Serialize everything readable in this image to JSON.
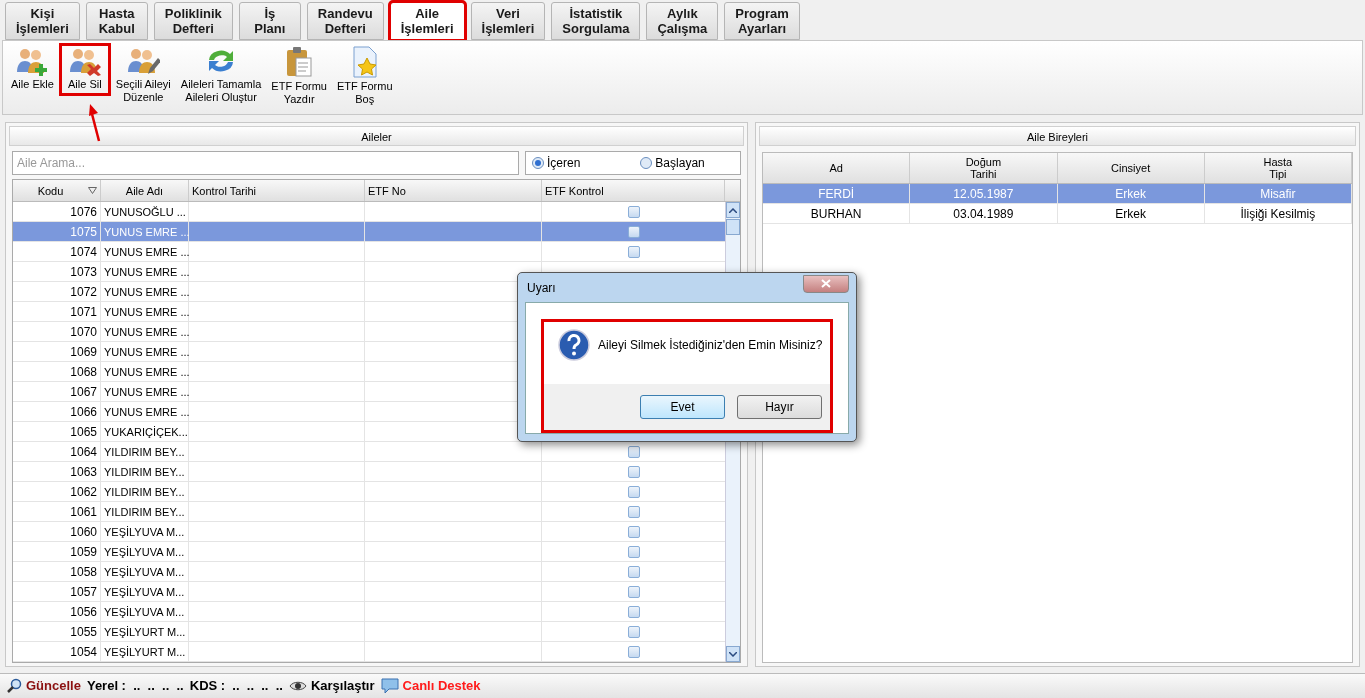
{
  "tabs": [
    {
      "label": "Kişi\nİşlemleri",
      "selected": false,
      "highlighted": false
    },
    {
      "label": "Hasta\nKabul",
      "selected": false,
      "highlighted": false
    },
    {
      "label": "Poliklinik\nDefteri",
      "selected": false,
      "highlighted": false
    },
    {
      "label": "İş\nPlanı",
      "selected": false,
      "highlighted": false
    },
    {
      "label": "Randevu\nDefteri",
      "selected": false,
      "highlighted": false
    },
    {
      "label": "Aile\nİşlemleri",
      "selected": true,
      "highlighted": true
    },
    {
      "label": "Veri\nİşlemleri",
      "selected": false,
      "highlighted": false
    },
    {
      "label": "İstatistik\nSorgulama",
      "selected": false,
      "highlighted": false
    },
    {
      "label": "Aylık\nÇalışma",
      "selected": false,
      "highlighted": false
    },
    {
      "label": "Program\nAyarları",
      "selected": false,
      "highlighted": false
    }
  ],
  "toolbar": [
    {
      "kind": "add-family",
      "label": "Aile Ekle",
      "highlighted": false
    },
    {
      "kind": "delete-family",
      "label": "Aile Sil",
      "highlighted": true
    },
    {
      "kind": "edit-family",
      "label": "Seçili Aileyi\nDüzenle",
      "highlighted": false
    },
    {
      "kind": "refresh",
      "label": "Aileleri Tamamla\nAileleri Oluştur",
      "highlighted": false
    },
    {
      "kind": "clipboard",
      "label": "ETF Formu\nYazdır",
      "highlighted": false
    },
    {
      "kind": "star-doc",
      "label": "ETF Formu\nBoş",
      "highlighted": false
    }
  ],
  "families_panel": {
    "title": "Aileler",
    "search": {
      "placeholder": "Aile Arama..."
    },
    "match_options": [
      {
        "label": "İçeren",
        "selected": true
      },
      {
        "label": "Başlayan",
        "selected": false
      }
    ],
    "columns": [
      "Kodu",
      "Aile Adı",
      "Kontrol Tarihi",
      "ETF No",
      "ETF Kontrol"
    ],
    "rows": [
      {
        "code": "1076",
        "name": "YUNUSOĞLU ...",
        "selected": false,
        "etf_checked": false
      },
      {
        "code": "1075",
        "name": "YUNUS EMRE ...",
        "selected": true,
        "etf_checked": false
      },
      {
        "code": "1074",
        "name": "YUNUS EMRE ...",
        "selected": false,
        "etf_checked": false
      },
      {
        "code": "1073",
        "name": "YUNUS EMRE ...",
        "selected": false
      },
      {
        "code": "1072",
        "name": "YUNUS EMRE ...",
        "selected": false
      },
      {
        "code": "1071",
        "name": "YUNUS EMRE ...",
        "selected": false
      },
      {
        "code": "1070",
        "name": "YUNUS EMRE ...",
        "selected": false
      },
      {
        "code": "1069",
        "name": "YUNUS EMRE ...",
        "selected": false
      },
      {
        "code": "1068",
        "name": "YUNUS EMRE ...",
        "selected": false
      },
      {
        "code": "1067",
        "name": "YUNUS EMRE ...",
        "selected": false
      },
      {
        "code": "1066",
        "name": "YUNUS EMRE ...",
        "selected": false
      },
      {
        "code": "1065",
        "name": "YUKARIÇİÇEK...",
        "selected": false
      },
      {
        "code": "1064",
        "name": "YILDIRIM BEY...",
        "selected": false,
        "etf_checked": false
      },
      {
        "code": "1063",
        "name": "YILDIRIM BEY...",
        "selected": false,
        "etf_checked": false
      },
      {
        "code": "1062",
        "name": "YILDIRIM BEY...",
        "selected": false,
        "etf_checked": false
      },
      {
        "code": "1061",
        "name": "YILDIRIM BEY...",
        "selected": false,
        "etf_checked": false
      },
      {
        "code": "1060",
        "name": "YEŞİLYUVA M...",
        "selected": false,
        "etf_checked": false
      },
      {
        "code": "1059",
        "name": "YEŞİLYUVA M...",
        "selected": false,
        "etf_checked": false
      },
      {
        "code": "1058",
        "name": "YEŞİLYUVA M...",
        "selected": false,
        "etf_checked": false
      },
      {
        "code": "1057",
        "name": "YEŞİLYUVA M...",
        "selected": false,
        "etf_checked": false
      },
      {
        "code": "1056",
        "name": "YEŞİLYUVA M...",
        "selected": false,
        "etf_checked": false
      },
      {
        "code": "1055",
        "name": "YEŞİLYURT M...",
        "selected": false,
        "etf_checked": false
      },
      {
        "code": "1054",
        "name": "YEŞİLYURT M...",
        "selected": false,
        "etf_checked": false
      }
    ]
  },
  "members_panel": {
    "title": "Aile Bireyleri",
    "columns": [
      "Ad",
      "Doğum\nTarihi",
      "Cinsiyet",
      "Hasta\nTipi"
    ],
    "rows": [
      {
        "cells": [
          "FERDİ",
          "12.05.1987",
          "Erkek",
          "Misafir"
        ],
        "selected": true
      },
      {
        "cells": [
          "BURHAN",
          "03.04.1989",
          "Erkek",
          "İlişiği Kesilmiş"
        ],
        "selected": false
      }
    ]
  },
  "dialog": {
    "title": "Uyarı",
    "message": "Aileyi Silmek İstediğiniz'den Emin Misiniz?",
    "highlighted": true,
    "buttons": [
      "Evet",
      "Hayır"
    ]
  },
  "status_bar": [
    {
      "kind": "search",
      "text": "Güncelle",
      "color": "#8b1010"
    },
    {
      "kind": "plain",
      "text": "Yerel :  ..  ..  ..  ..",
      "color": "#000000"
    },
    {
      "kind": "plain",
      "text": "KDS :  ..  ..  ..  ..",
      "color": "#000000"
    },
    {
      "kind": "eye",
      "text": "Karşılaştır",
      "color": "#000000"
    },
    {
      "kind": "chat",
      "text": "Canlı Destek",
      "color": "#ff1a1a"
    }
  ]
}
